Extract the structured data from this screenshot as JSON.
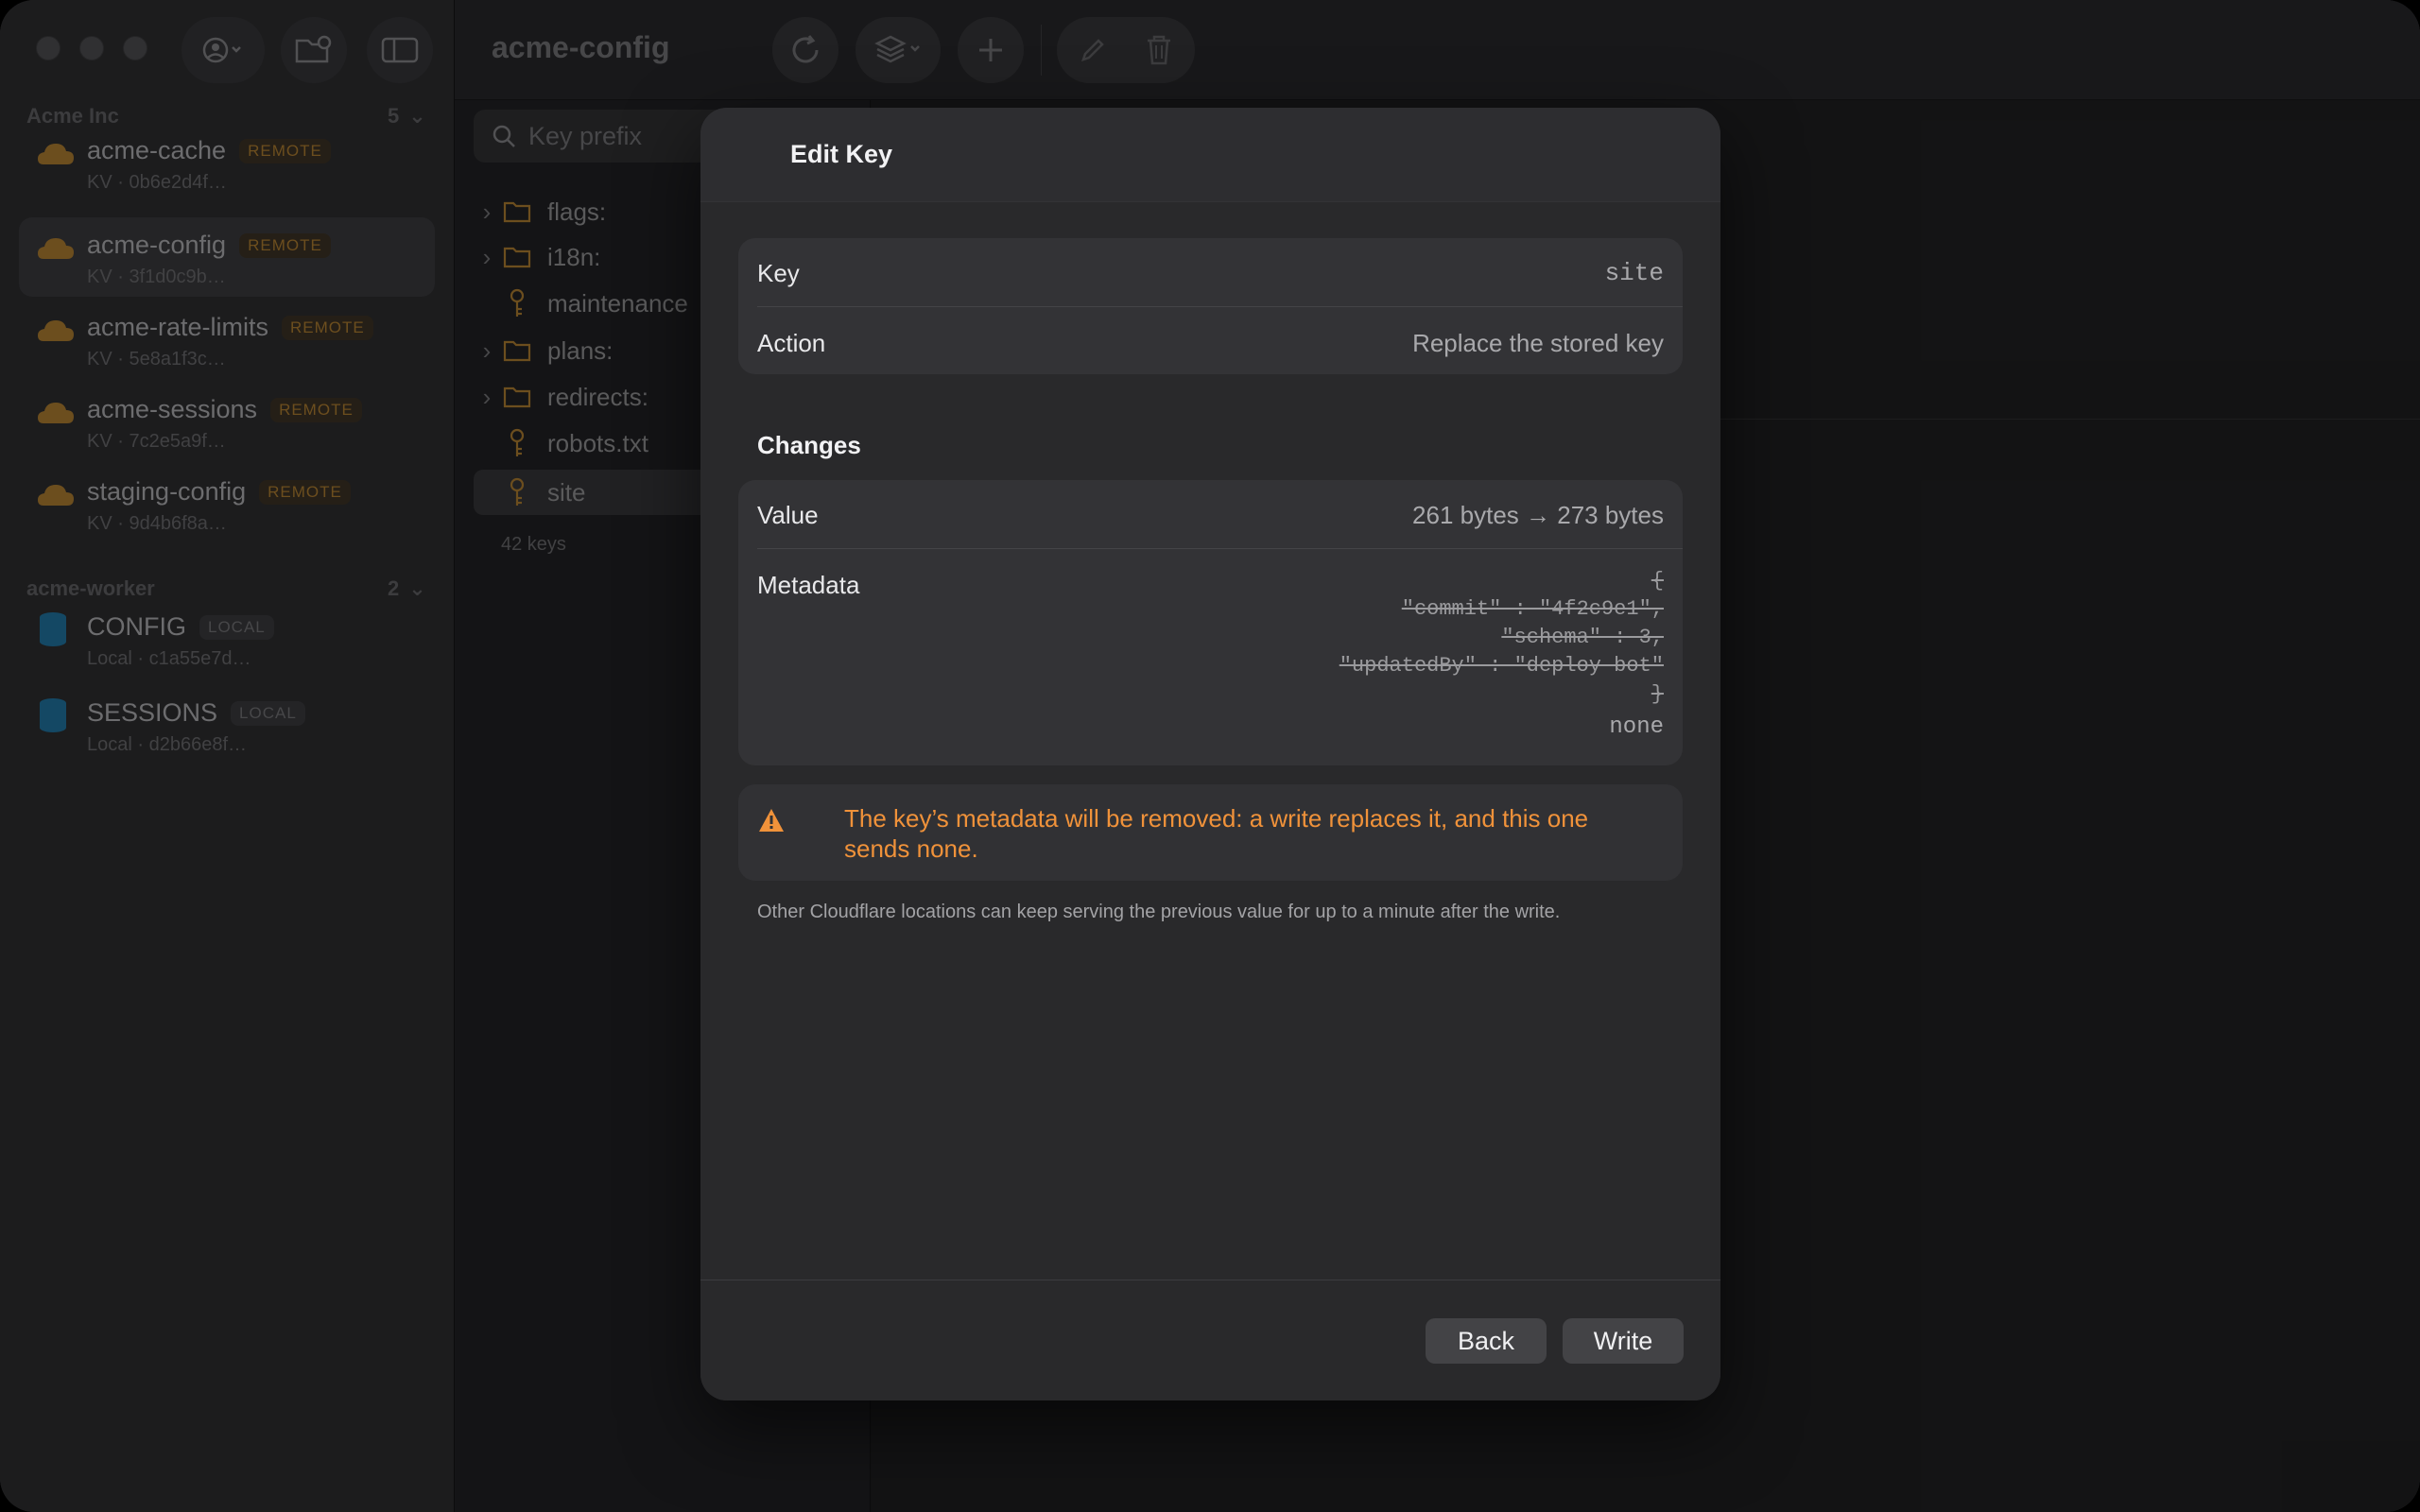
{
  "window": {
    "title": "acme-config"
  },
  "sidebar": {
    "groups": [
      {
        "name": "Acme Inc",
        "count": "5",
        "items": [
          {
            "name": "acme-cache",
            "badge": "REMOTE",
            "sub": "KV · 0b6e2d4f…"
          },
          {
            "name": "acme-config",
            "badge": "REMOTE",
            "sub": "KV · 3f1d0c9b…"
          },
          {
            "name": "acme-rate-limits",
            "badge": "REMOTE",
            "sub": "KV · 5e8a1f3c…"
          },
          {
            "name": "acme-sessions",
            "badge": "REMOTE",
            "sub": "KV · 7c2e5a9f…"
          },
          {
            "name": "staging-config",
            "badge": "REMOTE",
            "sub": "KV · 9d4b6f8a…"
          }
        ]
      },
      {
        "name": "acme-worker",
        "count": "2",
        "items": [
          {
            "name": "CONFIG",
            "badge": "LOCAL",
            "sub": "Local · c1a55e7d…"
          },
          {
            "name": "SESSIONS",
            "badge": "LOCAL",
            "sub": "Local · d2b66e8f…"
          }
        ]
      }
    ]
  },
  "keys": {
    "search_placeholder": "Key prefix",
    "items": [
      {
        "label": "flags:",
        "type": "folder"
      },
      {
        "label": "i18n:",
        "type": "folder"
      },
      {
        "label": "maintenance",
        "type": "key"
      },
      {
        "label": "plans:",
        "type": "folder"
      },
      {
        "label": "redirects:",
        "type": "folder"
      },
      {
        "label": "robots.txt",
        "type": "key"
      },
      {
        "label": "site",
        "type": "key"
      }
    ],
    "count": "42 keys"
  },
  "dialog": {
    "title": "Edit Key",
    "key_label": "Key",
    "key_value": "site",
    "action_label": "Action",
    "action_value": "Replace the stored key",
    "changes_title": "Changes",
    "value_label": "Value",
    "value_change": "261 bytes → 273 bytes",
    "metadata_label": "Metadata",
    "metadata_old": [
      "{",
      "\"commit\" : \"4f2c9e1\",",
      "\"schema\" : 3,",
      "\"updatedBy\" : \"deploy-bot\"",
      "}"
    ],
    "metadata_new": "none",
    "warning": "The key’s metadata will be removed: a write replaces it, and this one sends none.",
    "footnote": "Other Cloudflare locations can keep serving the previous value for up to a minute after the write.",
    "back_label": "Back",
    "write_label": "Write"
  },
  "colors": {
    "accent_remote": "#a7782f",
    "warning": "#f0923a",
    "local_db": "#1f6f9a"
  }
}
